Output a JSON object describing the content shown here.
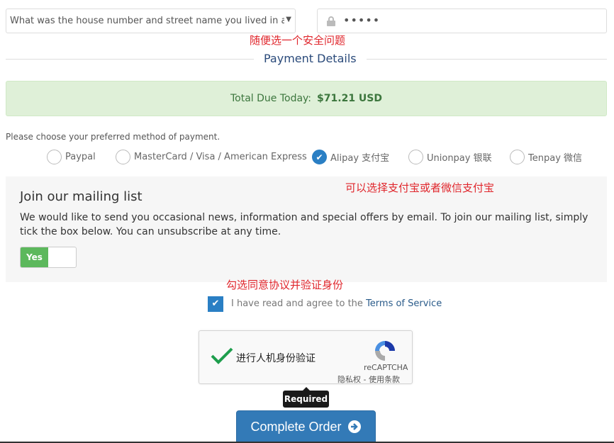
{
  "security": {
    "question": "What was the house number and street name you lived in as a c",
    "answer_masked": "•••••"
  },
  "annotations": {
    "security": "随便选一个安全问题",
    "payment": "可以选择支付宝或者微信支付宝",
    "agree": "勾选同意协议并验证身份"
  },
  "payment": {
    "title": "Payment Details",
    "total_label": "Total Due Today:",
    "total_value": "$71.21 USD",
    "hint": "Please choose your preferred method of payment.",
    "methods": [
      {
        "label": "Paypal",
        "selected": false
      },
      {
        "label": "MasterCard / Visa / American Express",
        "selected": false
      },
      {
        "label": "Alipay 支付宝",
        "selected": true
      },
      {
        "label": "Unionpay 银联",
        "selected": false
      },
      {
        "label": "Tenpay 微信",
        "selected": false
      }
    ]
  },
  "mailing": {
    "title": "Join our mailing list",
    "text": "We would like to send you occasional news, information and special offers by email. To join our mailing list, simply tick the box below. You can unsubscribe at any time.",
    "toggle": "Yes"
  },
  "terms": {
    "prefix": "I have read and agree to the ",
    "link": "Terms of Service",
    "checked": true
  },
  "recaptcha": {
    "label": "进行人机身份验证",
    "brand": "reCAPTCHA",
    "links": "隐私权 - 使用条款",
    "tooltip": "Required"
  },
  "submit": {
    "label": "Complete Order"
  },
  "colors": {
    "accent": "#337ab7",
    "success_bg": "#dff0d8",
    "annotation": "#e0262c"
  }
}
